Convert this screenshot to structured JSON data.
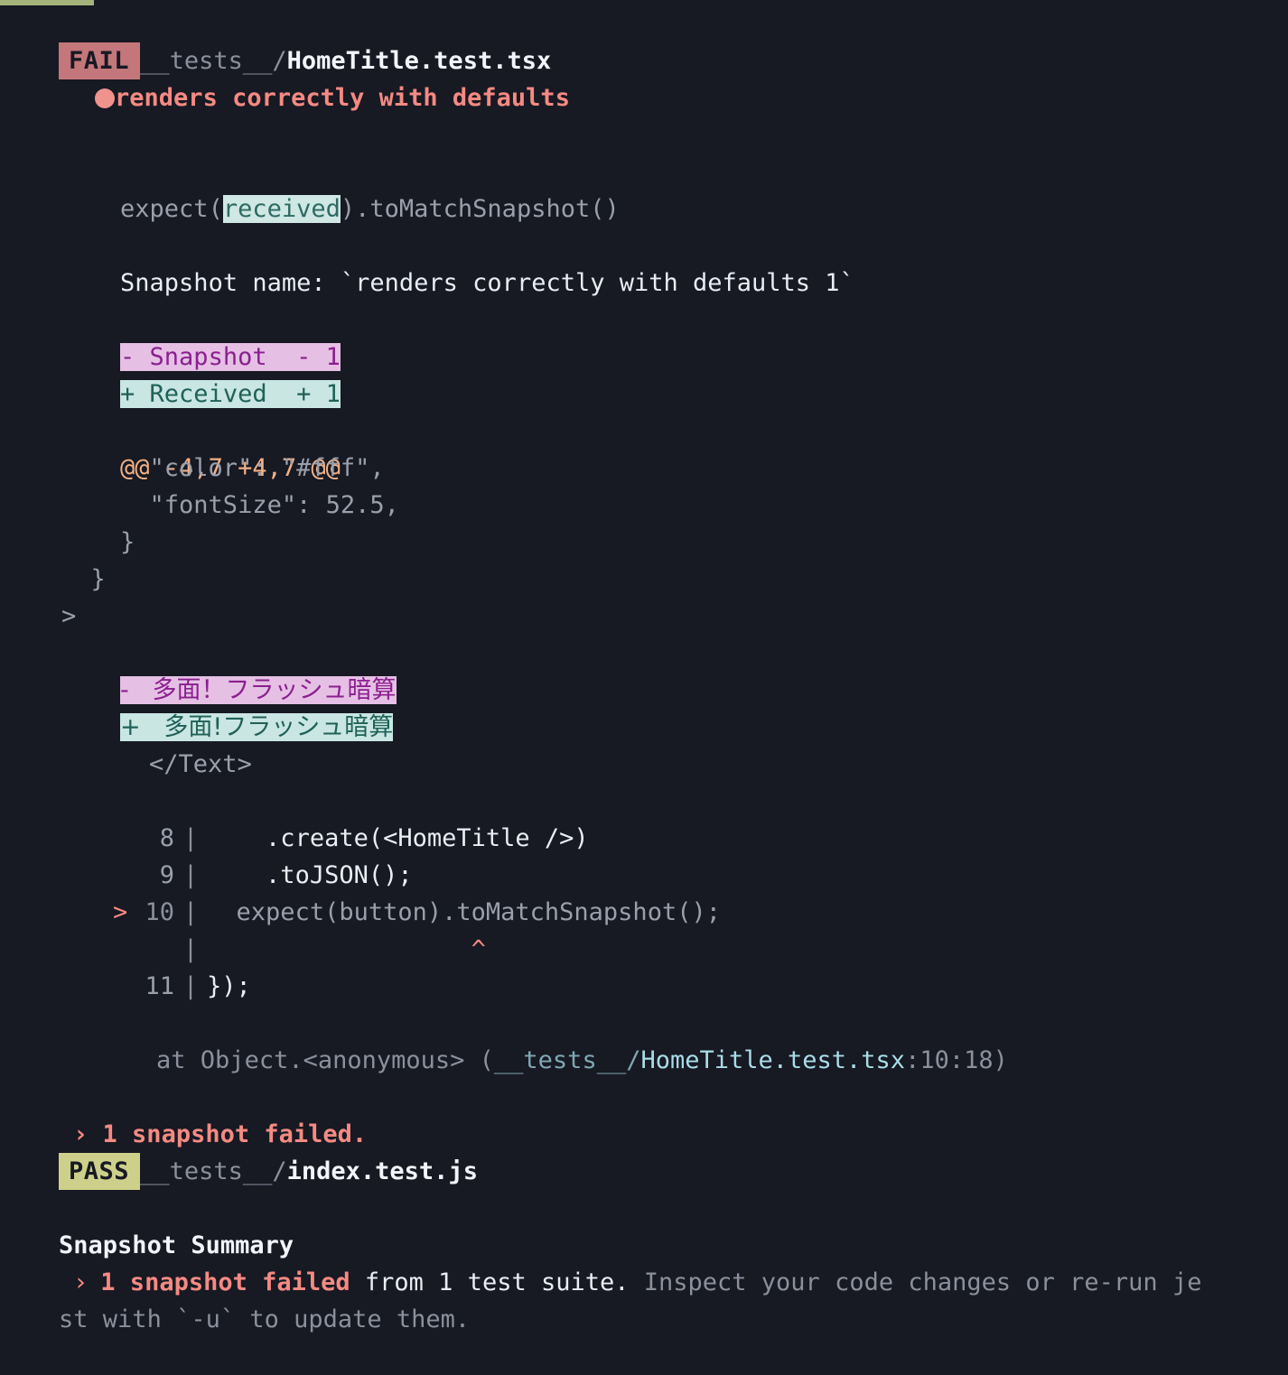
{
  "terminal": {
    "background": "#171923",
    "foreground": "#c3c8d2"
  },
  "suites": [
    {
      "status": "FAIL",
      "badge_bg": "#c4777a",
      "dir": "__tests__/",
      "file": "HomeTitle.test.tsx"
    },
    {
      "status": "PASS",
      "badge_bg": "#cdd08a",
      "dir": "__tests__/",
      "file": "index.test.js"
    }
  ],
  "failure": {
    "test_name": "renders correctly with defaults",
    "bullet_color": "#ef938c",
    "matcher_prefix": "expect(",
    "matcher_received": "received",
    "matcher_suffix": ").toMatchSnapshot()",
    "snapshot_name_label": "Snapshot name: ",
    "snapshot_name_value": "`renders correctly with defaults 1`",
    "legend_removed": "- Snapshot  - 1",
    "legend_added": "+ Received  + 1",
    "hunk_header": "@@ -4,7 +4,7 @@",
    "context_lines": [
      "      \"color\": \"#fff\",",
      "      \"fontSize\": 52.5,",
      "    }",
      "  }",
      ">"
    ],
    "diff_removed": "-   多面！フラッシュ暗算",
    "diff_added": "+   多面!フラッシュ暗算",
    "closing_tag": "</Text>",
    "code_frame": [
      {
        "marker": "",
        "number": "8",
        "sep": "|",
        "code": "    .create(<HomeTitle />)",
        "highlight": false
      },
      {
        "marker": "",
        "number": "9",
        "sep": "|",
        "code": "    .toJSON();",
        "highlight": false
      },
      {
        "marker": ">",
        "number": "10",
        "sep": "|",
        "code": "  expect(button).toMatchSnapshot();",
        "highlight": true
      },
      {
        "marker": "",
        "number": "",
        "sep": "|",
        "code": "                  ^",
        "highlight": false
      },
      {
        "marker": "",
        "number": "11",
        "sep": "|",
        "code": "});",
        "highlight": false
      }
    ],
    "stack_prefix": "at Object.<anonymous> (",
    "stack_dir": "__tests__/",
    "stack_file": "HomeTitle.test.tsx",
    "stack_location": ":10:18",
    "stack_suffix": ")",
    "snapshot_failed_line": "› 1 snapshot failed."
  },
  "summary": {
    "title": "Snapshot Summary",
    "bullet": "›",
    "failed_text": "1 snapshot failed",
    "from_text": " from 1 test suite. ",
    "hint_line_1": "Inspect your code changes or re-run je",
    "hint_line_2": "st with `-u` to update them."
  }
}
